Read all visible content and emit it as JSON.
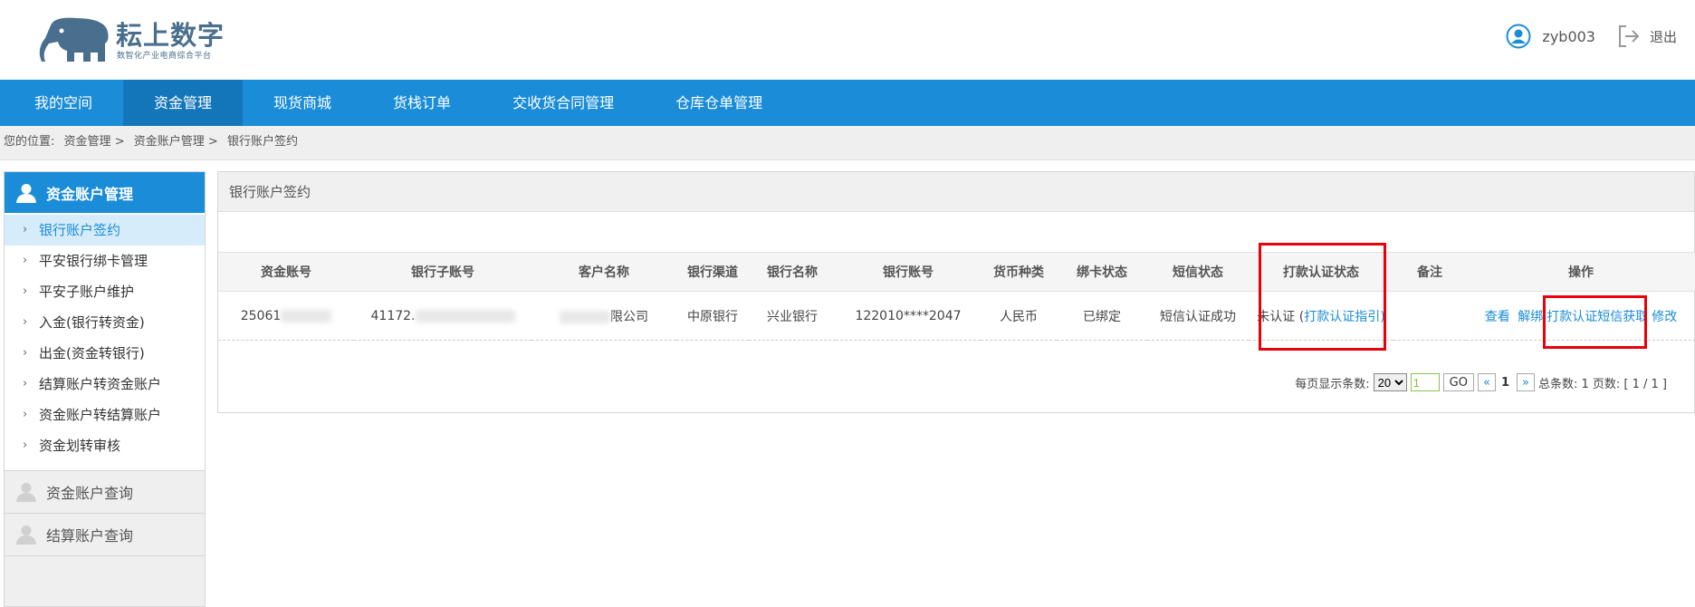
{
  "header": {
    "logo_title": "耘上数字",
    "logo_subtitle": "数智化产业电商综合平台",
    "username": "zyb003",
    "logout_label": "退出"
  },
  "nav": {
    "items": [
      {
        "label": "我的空间"
      },
      {
        "label": "资金管理"
      },
      {
        "label": "现货商城"
      },
      {
        "label": "货栈订单"
      },
      {
        "label": "交收货合同管理"
      },
      {
        "label": "仓库仓单管理"
      }
    ]
  },
  "breadcrumb": {
    "prefix": "您的位置:",
    "items": [
      "资金管理",
      "资金账户管理",
      "银行账户签约"
    ],
    "sep": ">"
  },
  "sidebar": {
    "header": "资金账户管理",
    "items": [
      {
        "label": "银行账户签约"
      },
      {
        "label": "平安银行绑卡管理"
      },
      {
        "label": "平安子账户维护"
      },
      {
        "label": "入金(银行转资金)"
      },
      {
        "label": "出金(资金转银行)"
      },
      {
        "label": "结算账户转资金账户"
      },
      {
        "label": "资金账户转结算账户"
      },
      {
        "label": "资金划转审核"
      }
    ],
    "groups": [
      {
        "label": "资金账户查询"
      },
      {
        "label": "结算账户查询"
      }
    ]
  },
  "panel": {
    "title": "银行账户签约",
    "columns": [
      "资金账号",
      "银行子账号",
      "客户名称",
      "银行渠道",
      "银行名称",
      "银行账号",
      "货币种类",
      "绑卡状态",
      "短信状态",
      "打款认证状态",
      "备注",
      "操作"
    ],
    "row": {
      "fund_account": "25061",
      "sub_account": "41172.",
      "customer_name": "限公司",
      "channel": "中原银行",
      "bank_name": "兴业银行",
      "bank_account": "122010****2047",
      "currency": "人民币",
      "card_status": "已绑定",
      "sms_status": "短信认证成功",
      "auth_status_prefix": "未认证 (",
      "auth_guide_link": "打款认证指引",
      "auth_status_suffix": ")",
      "remark": "",
      "actions": {
        "view": "查看",
        "unbind": "解绑",
        "get_sms": "打款认证短信获取",
        "edit": "修改"
      }
    }
  },
  "pager": {
    "per_page_label": "每页显示条数:",
    "per_page_value": "20",
    "page_input": "1",
    "go_label": "GO",
    "prev": "«",
    "current": "1",
    "next": "»",
    "total_label": "总条数: 1 页数: [ 1 / 1 ]"
  },
  "colors": {
    "primary": "#1a8cd8",
    "nav_active": "#1476ba",
    "highlight": "#e8000a"
  }
}
